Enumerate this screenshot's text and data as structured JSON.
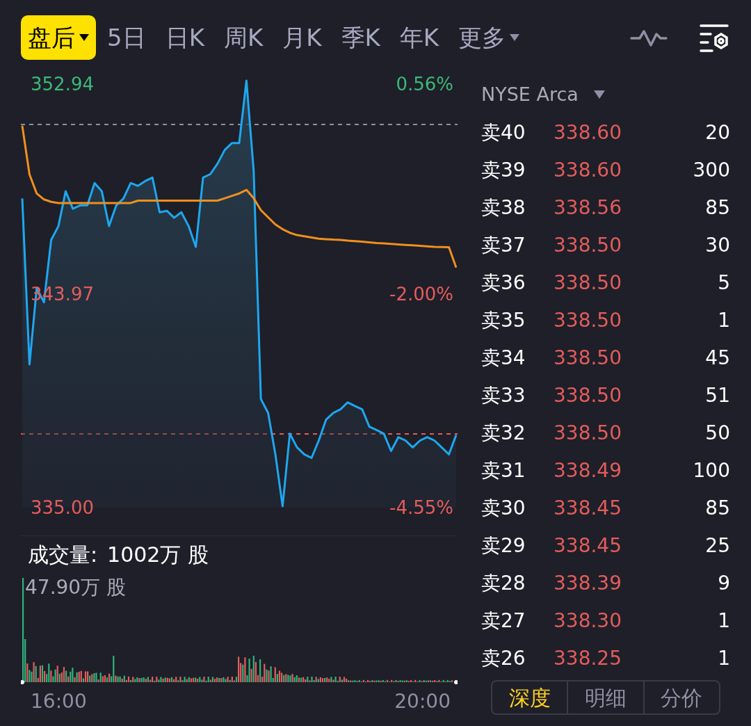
{
  "period_tabs": [
    {
      "label": "盘后",
      "selected": true,
      "has_caret": true
    },
    {
      "label": "5日",
      "selected": false,
      "has_caret": false
    },
    {
      "label": "日K",
      "selected": false,
      "has_caret": false
    },
    {
      "label": "周K",
      "selected": false,
      "has_caret": false
    },
    {
      "label": "月K",
      "selected": false,
      "has_caret": false
    },
    {
      "label": "季K",
      "selected": false,
      "has_caret": false
    },
    {
      "label": "年K",
      "selected": false,
      "has_caret": false
    },
    {
      "label": "更多",
      "selected": false,
      "has_caret": true
    }
  ],
  "price_chart": {
    "max_change": "0.56%",
    "mid_change": "-2.00%",
    "min_change": "-4.55%",
    "chart_data": {
      "type": "area",
      "ylim": [
        335.0,
        352.94
      ],
      "yticks": [
        {
          "value": 352.94,
          "label": "352.94"
        },
        {
          "value": 343.97,
          "label": "343.97"
        },
        {
          "value": 335.0,
          "label": "335.00"
        }
      ],
      "series": [
        {
          "color": "#1ea7f0",
          "values": [
            347.99,
            341.02,
            344.22,
            343.63,
            346.25,
            346.83,
            348.29,
            347.56,
            347.7,
            347.7,
            348.64,
            348.29,
            346.83,
            347.7,
            347.99,
            348.64,
            348.52,
            348.72,
            348.87,
            347.41,
            347.47,
            347.18,
            347.41,
            346.83,
            345.96,
            348.87,
            349.01,
            349.45,
            350.03,
            350.32,
            350.32,
            352.94,
            349.16,
            339.56,
            338.98,
            337.24,
            335.06,
            338.11,
            337.53,
            337.24,
            337.09,
            337.82,
            338.69,
            338.98,
            339.13,
            339.42,
            339.27,
            339.13,
            338.4,
            338.26,
            338.11,
            337.38,
            337.96,
            337.82,
            337.53,
            337.82,
            337.96,
            337.82,
            337.53,
            337.24,
            338.05
          ]
        },
        {
          "type": "line",
          "color": "#f0901e",
          "values": [
            351.05,
            349.0,
            348.2,
            347.95,
            347.85,
            347.8,
            347.8,
            347.8,
            347.8,
            347.8,
            347.8,
            347.8,
            347.8,
            347.8,
            347.8,
            347.8,
            347.9,
            347.9,
            347.9,
            347.9,
            347.9,
            347.9,
            347.9,
            347.9,
            347.9,
            347.9,
            347.9,
            347.9,
            348.0,
            348.1,
            348.2,
            348.35,
            348.0,
            347.5,
            347.2,
            346.9,
            346.7,
            346.55,
            346.45,
            346.4,
            346.35,
            346.3,
            346.28,
            346.26,
            346.25,
            346.22,
            346.2,
            346.18,
            346.15,
            346.12,
            346.1,
            346.08,
            346.06,
            346.04,
            346.02,
            346.0,
            345.98,
            345.96,
            345.95,
            345.94,
            345.09
          ]
        }
      ]
    }
  },
  "volume": {
    "label": "成交量:",
    "total": "1002万 股",
    "max": "47.90万 股",
    "start_time": "16:00",
    "end_time": "20:00"
  },
  "order_book": {
    "exchange": "NYSE Arca",
    "rows": [
      {
        "label": "卖40",
        "price": "338.60",
        "size": "20"
      },
      {
        "label": "卖39",
        "price": "338.60",
        "size": "300"
      },
      {
        "label": "卖38",
        "price": "338.56",
        "size": "85"
      },
      {
        "label": "卖37",
        "price": "338.50",
        "size": "30"
      },
      {
        "label": "卖36",
        "price": "338.50",
        "size": "5"
      },
      {
        "label": "卖35",
        "price": "338.50",
        "size": "1"
      },
      {
        "label": "卖34",
        "price": "338.50",
        "size": "45"
      },
      {
        "label": "卖33",
        "price": "338.50",
        "size": "51"
      },
      {
        "label": "卖32",
        "price": "338.50",
        "size": "50"
      },
      {
        "label": "卖31",
        "price": "338.49",
        "size": "100"
      },
      {
        "label": "卖30",
        "price": "338.45",
        "size": "85"
      },
      {
        "label": "卖29",
        "price": "338.45",
        "size": "25"
      },
      {
        "label": "卖28",
        "price": "338.39",
        "size": "9"
      },
      {
        "label": "卖27",
        "price": "338.30",
        "size": "1"
      },
      {
        "label": "卖26",
        "price": "338.25",
        "size": "1"
      }
    ]
  },
  "detail_tabs": [
    {
      "label": "深度",
      "selected": true
    },
    {
      "label": "明细",
      "selected": false
    },
    {
      "label": "分价",
      "selected": false
    }
  ]
}
